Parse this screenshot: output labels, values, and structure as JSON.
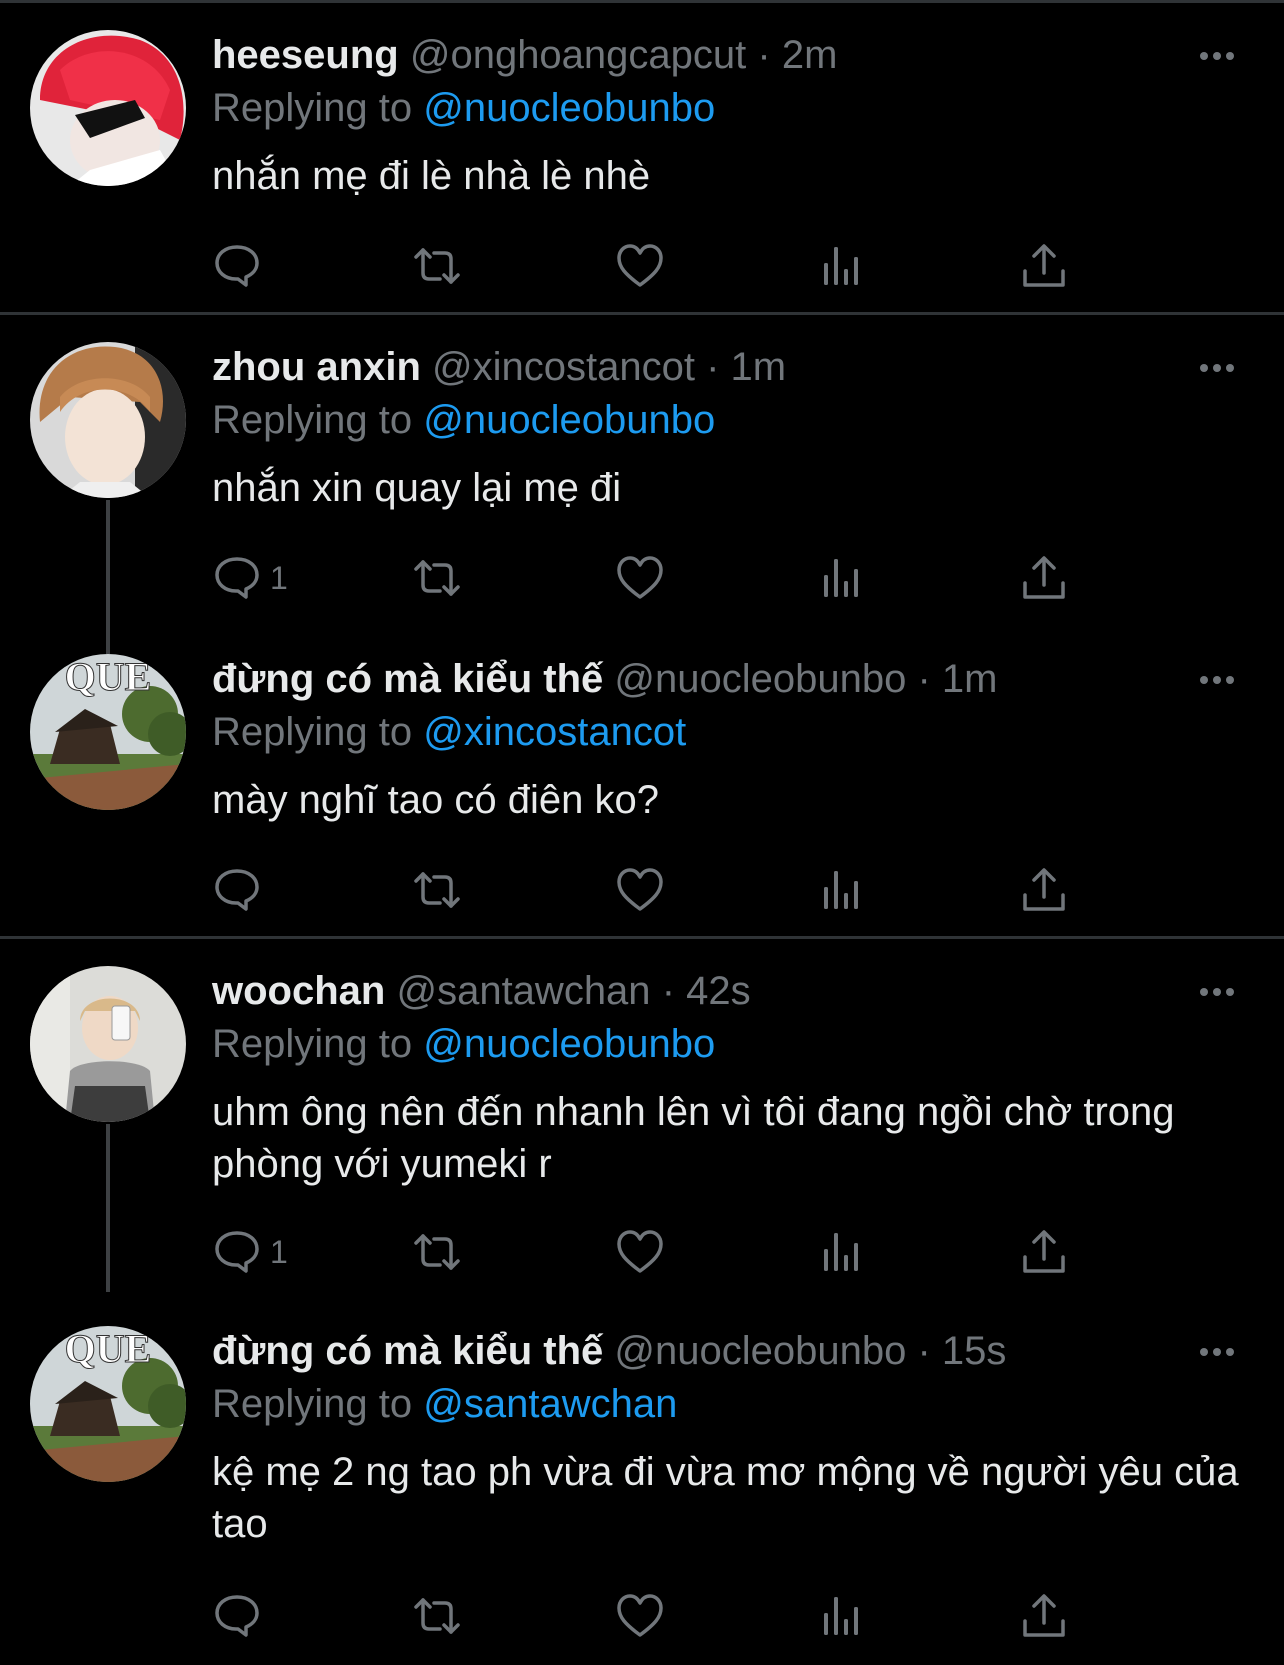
{
  "colors": {
    "background": "#000000",
    "text": "#e7e9ea",
    "muted": "#71767b",
    "link": "#1d9bf0",
    "divider": "#2f3336"
  },
  "tweets": [
    {
      "name": "heeseung",
      "handle": "@onghoangcapcut",
      "separator": "·",
      "time": "2m",
      "replying_prefix": "Replying to",
      "replying_to": "@nuocleobunbo",
      "text": "nhắn mẹ đi lè nhà lè nhè",
      "reply_count": "",
      "avatar_icon": "red-hair-avatar"
    },
    {
      "name": "zhou anxin",
      "handle": "@xincostancot",
      "separator": "·",
      "time": "1m",
      "replying_prefix": "Replying to",
      "replying_to": "@nuocleobunbo",
      "text": "nhắn xin quay lại mẹ đi",
      "reply_count": "1",
      "avatar_icon": "brown-hair-avatar"
    },
    {
      "name": "đừng có mà kiểu thế",
      "handle": "@nuocleobunbo",
      "separator": "·",
      "time": "1m",
      "replying_prefix": "Replying to",
      "replying_to": "@xincostancot",
      "text": "mày nghĩ tao có điên ko?",
      "reply_count": "",
      "avatar_icon": "que-house-avatar",
      "avatar_label": "QUE"
    },
    {
      "name": "woochan",
      "handle": "@santawchan",
      "separator": "·",
      "time": "42s",
      "replying_prefix": "Replying to",
      "replying_to": "@nuocleobunbo",
      "text": "uhm ông nên đến nhanh lên vì tôi đang ngồi chờ trong phòng với yumeki r",
      "reply_count": "1",
      "avatar_icon": "mirror-selfie-avatar"
    },
    {
      "name": "đừng có mà kiểu thế",
      "handle": "@nuocleobunbo",
      "separator": "·",
      "time": "15s",
      "replying_prefix": "Replying to",
      "replying_to": "@santawchan",
      "text": "kệ mẹ 2 ng tao ph vừa đi vừa mơ mộng về người yêu của tao",
      "reply_count": "",
      "avatar_icon": "que-house-avatar",
      "avatar_label": "QUE"
    }
  ],
  "action_icons": [
    "reply-icon",
    "retweet-icon",
    "like-icon",
    "views-icon",
    "share-icon"
  ]
}
